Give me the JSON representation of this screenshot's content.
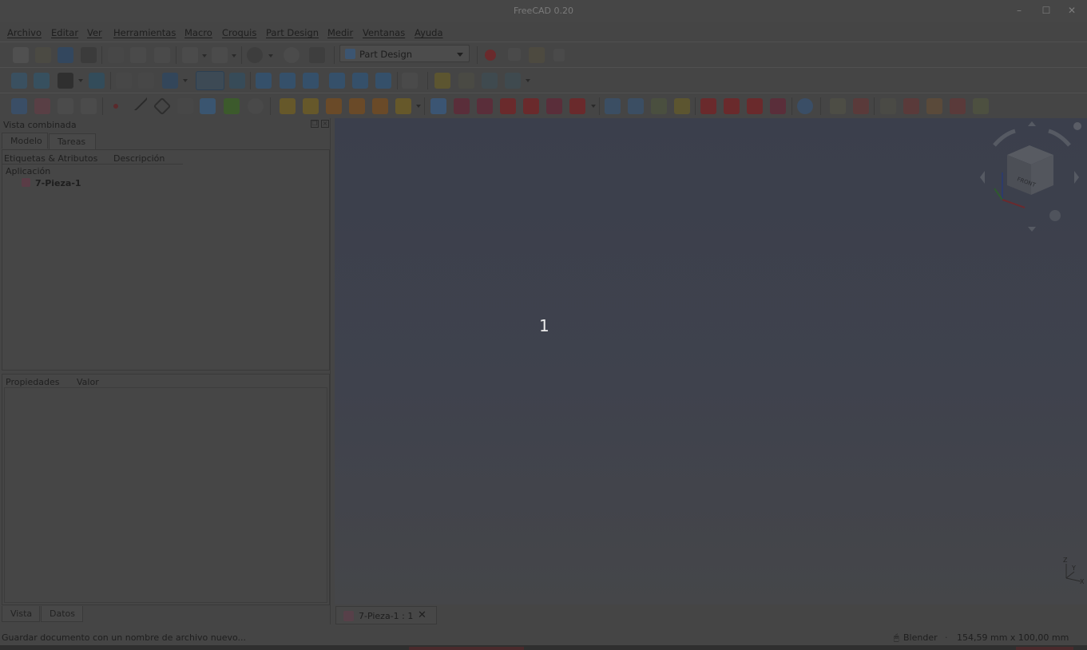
{
  "window": {
    "title": "FreeCAD 0.20"
  },
  "menu": [
    "Archivo",
    "Editar",
    "Ver",
    "Herramientas",
    "Macro",
    "Croquis",
    "Part Design",
    "Medir",
    "Ventanas",
    "Ayuda"
  ],
  "workbench": {
    "selected": "Part Design"
  },
  "combo": {
    "title": "Vista combinada",
    "tabs": [
      "Modelo",
      "Tareas"
    ],
    "tree_columns": [
      "Etiquetas & Atributos",
      "Descripción"
    ],
    "tree_group": "Aplicación",
    "tree_items": [
      "7-Pieza-1"
    ],
    "prop_columns": [
      "Propiedades",
      "Valor"
    ],
    "prop_tabs": [
      "Vista",
      "Datos"
    ]
  },
  "viewport": {
    "overlay_number": "1",
    "navcube_face": "FRONT",
    "axis_labels": [
      "Z",
      "Y",
      "X"
    ]
  },
  "document_tab": "7-Pieza-1 : 1",
  "status": {
    "message": "Guardar documento con un nombre de archivo nuevo...",
    "navigation": "Blender",
    "dimensions": "154,59 mm x 100,00 mm"
  },
  "colors": {
    "accent_red": "#7a2a2e",
    "accent_blue": "#35597f",
    "accent_yellow": "#7a6a25"
  }
}
